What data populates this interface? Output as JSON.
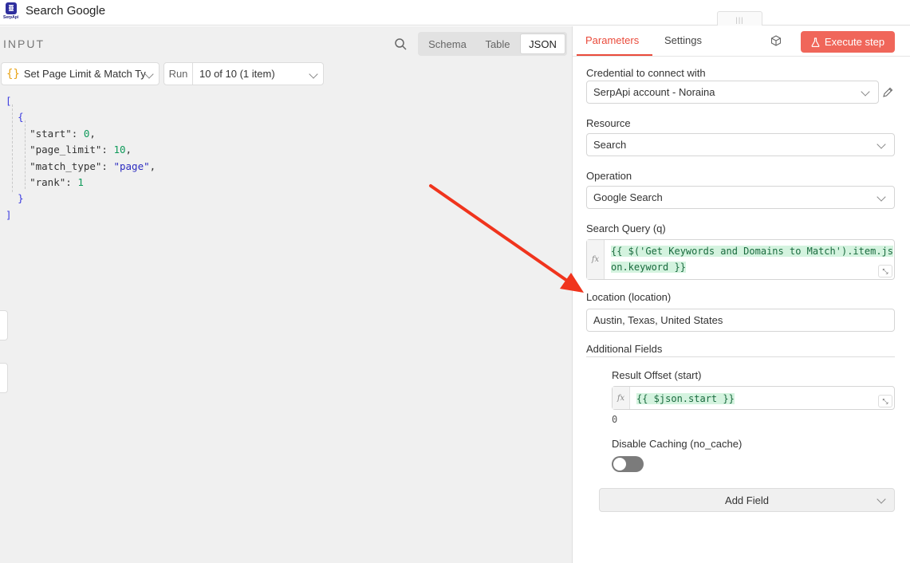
{
  "app": {
    "logo_text": "SerpApi",
    "title": "Search Google",
    "drag_handle": "|||"
  },
  "input_panel": {
    "label": "INPUT",
    "view_tabs": [
      "Schema",
      "Table",
      "JSON"
    ],
    "active_tab": "JSON",
    "node_select": {
      "icon": "{}",
      "value": "Set Page Limit & Match Ty"
    },
    "run": {
      "label": "Run",
      "value": "10 of 10 (1 item)"
    },
    "json_lines": [
      {
        "t": "[",
        "k": "",
        "v": "",
        "vt": ""
      },
      {
        "t": "{",
        "k": "",
        "v": "",
        "vt": ""
      },
      {
        "t": "",
        "k": "\"start\"",
        "v": "0",
        "vt": "num"
      },
      {
        "t": "",
        "k": "\"page_limit\"",
        "v": "10",
        "vt": "num"
      },
      {
        "t": "",
        "k": "\"match_type\"",
        "v": "\"page\"",
        "vt": "str"
      },
      {
        "t": "",
        "k": "\"rank\"",
        "v": "1",
        "vt": "num"
      },
      {
        "t": "}",
        "k": "",
        "v": "",
        "vt": ""
      },
      {
        "t": "]",
        "k": "",
        "v": "",
        "vt": ""
      }
    ]
  },
  "params_panel": {
    "tabs": {
      "parameters": "Parameters",
      "settings": "Settings"
    },
    "execute_button": "Execute step",
    "credential": {
      "label": "Credential to connect with",
      "value": "SerpApi account - Noraina"
    },
    "resource": {
      "label": "Resource",
      "value": "Search"
    },
    "operation": {
      "label": "Operation",
      "value": "Google Search"
    },
    "search_query": {
      "label": "Search Query (q)",
      "fx": "fx",
      "line1": "{{ $('Get Keywords and Domains to Match').item.js",
      "line2": "on.keyword }}"
    },
    "location": {
      "label": "Location (location)",
      "value": "Austin, Texas, United States"
    },
    "additional_fields": {
      "label": "Additional Fields"
    },
    "result_offset": {
      "label": "Result Offset (start)",
      "fx": "fx",
      "value": "{{ $json.start }}",
      "preview": "0"
    },
    "disable_caching": {
      "label": "Disable Caching (no_cache)",
      "enabled": false
    },
    "add_field_button": "Add Field"
  },
  "colors": {
    "accent": "#ea4b3b",
    "execute": "#f0665a",
    "arrow": "#f0341d"
  }
}
